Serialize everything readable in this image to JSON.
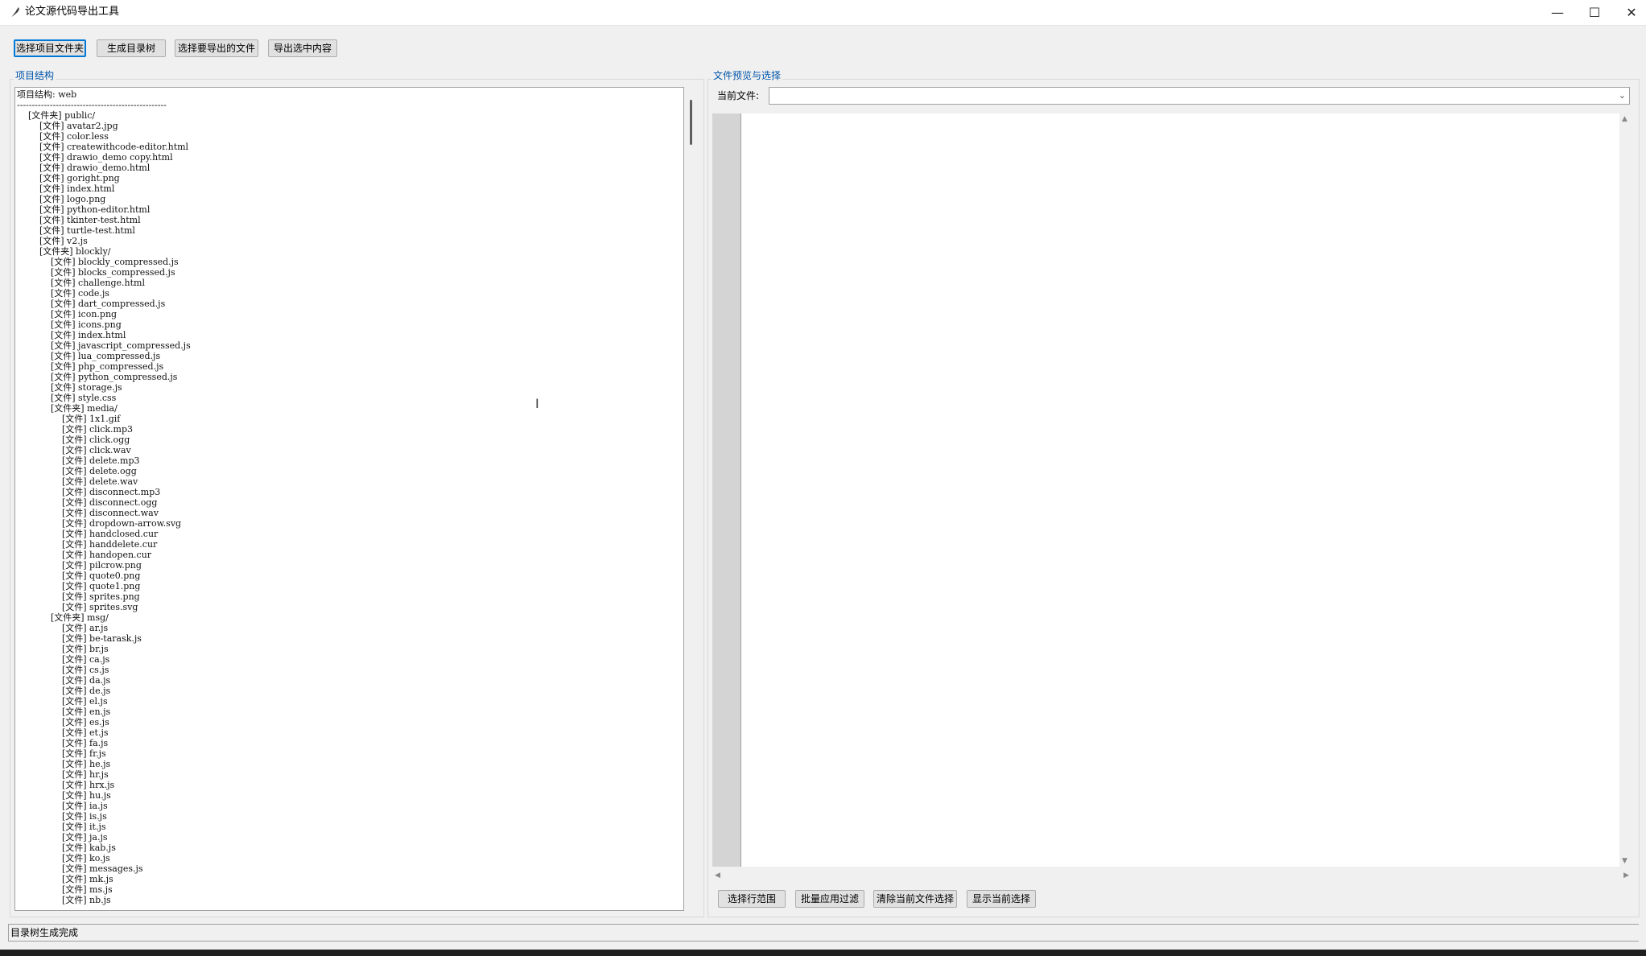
{
  "window": {
    "title": "论文源代码导出工具",
    "minimize": "—",
    "maximize": "☐",
    "close": "✕"
  },
  "toolbar": {
    "select_folder": "选择项目文件夹",
    "gen_tree": "生成目录树",
    "select_export": "选择要导出的文件",
    "export_selected": "导出选中内容"
  },
  "left_panel": {
    "title": "项目结构",
    "lines": [
      "项目结构: web",
      "--------------------------------------------------",
      "    [文件夹] public/",
      "        [文件] avatar2.jpg",
      "        [文件] color.less",
      "        [文件] createwithcode-editor.html",
      "        [文件] drawio_demo copy.html",
      "        [文件] drawio_demo.html",
      "        [文件] goright.png",
      "        [文件] index.html",
      "        [文件] logo.png",
      "        [文件] python-editor.html",
      "        [文件] tkinter-test.html",
      "        [文件] turtle-test.html",
      "        [文件] v2.js",
      "        [文件夹] blockly/",
      "            [文件] blockly_compressed.js",
      "            [文件] blocks_compressed.js",
      "            [文件] challenge.html",
      "            [文件] code.js",
      "            [文件] dart_compressed.js",
      "            [文件] icon.png",
      "            [文件] icons.png",
      "            [文件] index.html",
      "            [文件] javascript_compressed.js",
      "            [文件] lua_compressed.js",
      "            [文件] php_compressed.js",
      "            [文件] python_compressed.js",
      "            [文件] storage.js",
      "            [文件] style.css",
      "            [文件夹] media/",
      "                [文件] 1x1.gif",
      "                [文件] click.mp3",
      "                [文件] click.ogg",
      "                [文件] click.wav",
      "                [文件] delete.mp3",
      "                [文件] delete.ogg",
      "                [文件] delete.wav",
      "                [文件] disconnect.mp3",
      "                [文件] disconnect.ogg",
      "                [文件] disconnect.wav",
      "                [文件] dropdown-arrow.svg",
      "                [文件] handclosed.cur",
      "                [文件] handdelete.cur",
      "                [文件] handopen.cur",
      "                [文件] pilcrow.png",
      "                [文件] quote0.png",
      "                [文件] quote1.png",
      "                [文件] sprites.png",
      "                [文件] sprites.svg",
      "            [文件夹] msg/",
      "                [文件] ar.js",
      "                [文件] be-tarask.js",
      "                [文件] br.js",
      "                [文件] ca.js",
      "                [文件] cs.js",
      "                [文件] da.js",
      "                [文件] de.js",
      "                [文件] el.js",
      "                [文件] en.js",
      "                [文件] es.js",
      "                [文件] et.js",
      "                [文件] fa.js",
      "                [文件] fr.js",
      "                [文件] he.js",
      "                [文件] hr.js",
      "                [文件] hrx.js",
      "                [文件] hu.js",
      "                [文件] ia.js",
      "                [文件] is.js",
      "                [文件] it.js",
      "                [文件] ja.js",
      "                [文件] kab.js",
      "                [文件] ko.js",
      "                [文件] messages.js",
      "                [文件] mk.js",
      "                [文件] ms.js",
      "                [文件] nb.js"
    ]
  },
  "right_panel": {
    "title": "文件预览与选择",
    "current_file_label": "当前文件:",
    "current_file_value": "",
    "buttons": {
      "select_range": "选择行范围",
      "batch_filter": "批量应用过滤",
      "clear_selection": "清除当前文件选择",
      "show_selection": "显示当前选择"
    }
  },
  "status": {
    "text": "目录树生成完成"
  }
}
